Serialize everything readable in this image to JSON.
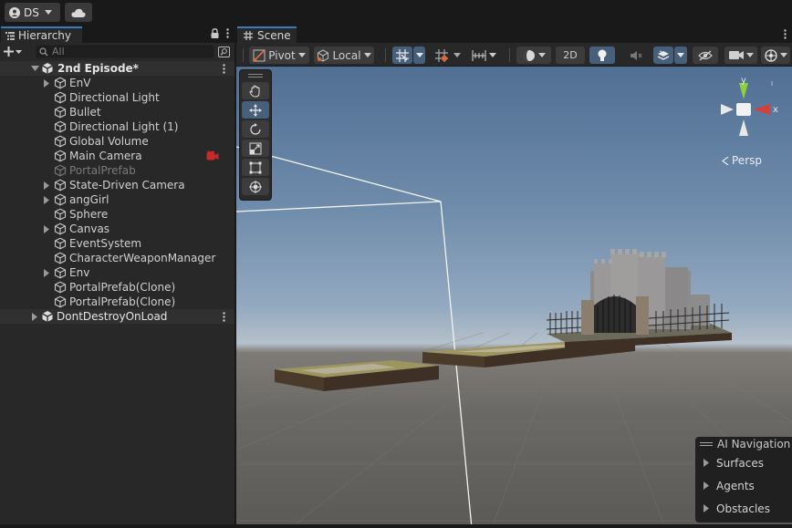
{
  "topbar": {
    "account_label": "DS"
  },
  "hierarchy": {
    "tab_label": "Hierarchy",
    "search_placeholder": "All",
    "scenes": [
      {
        "name": "2nd Episode*",
        "items": [
          {
            "name": "EnV",
            "expandable": true,
            "disabled": false
          },
          {
            "name": "Directional Light",
            "expandable": false,
            "disabled": false
          },
          {
            "name": "Bullet",
            "expandable": false,
            "disabled": false
          },
          {
            "name": "Directional Light (1)",
            "expandable": false,
            "disabled": false
          },
          {
            "name": "Global Volume",
            "expandable": false,
            "disabled": false
          },
          {
            "name": "Main Camera",
            "expandable": false,
            "disabled": false
          },
          {
            "name": "PortalPrefab",
            "expandable": false,
            "disabled": true
          },
          {
            "name": "State-Driven Camera",
            "expandable": true,
            "disabled": false
          },
          {
            "name": "angGirl",
            "expandable": true,
            "disabled": false
          },
          {
            "name": "Sphere",
            "expandable": false,
            "disabled": false
          },
          {
            "name": "Canvas",
            "expandable": true,
            "disabled": false
          },
          {
            "name": "EventSystem",
            "expandable": false,
            "disabled": false
          },
          {
            "name": "CharacterWeaponManager",
            "expandable": false,
            "disabled": false
          },
          {
            "name": "Env",
            "expandable": true,
            "disabled": false
          },
          {
            "name": "PortalPrefab(Clone)",
            "expandable": false,
            "disabled": false
          },
          {
            "name": "PortalPrefab(Clone)",
            "expandable": false,
            "disabled": false
          }
        ]
      },
      {
        "name": "DontDestroyOnLoad",
        "items": []
      }
    ]
  },
  "scene_view": {
    "tab_label": "Scene",
    "pivot_label": "Pivot",
    "space_label": "Local",
    "mode_2d_label": "2D",
    "persp_label": "Persp",
    "gizmo_axes": {
      "y": "y",
      "x": "x"
    },
    "ai_navigation": {
      "title": "AI Navigation",
      "items": [
        "Surfaces",
        "Agents",
        "Obstacles"
      ]
    }
  },
  "colors": {
    "accent_blue": "#3a79bb",
    "active_button": "#46607c",
    "gizmo_x": "#d5403a",
    "gizmo_y": "#8bd23a"
  }
}
